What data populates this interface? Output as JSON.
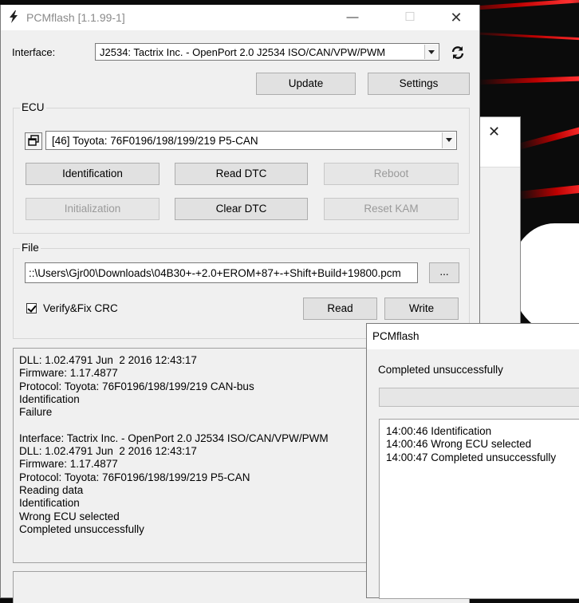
{
  "window": {
    "title": "PCMflash [1.1.99-1]",
    "minimize_glyph": "—",
    "maximize_glyph": "☐",
    "close_glyph": "✕"
  },
  "interface": {
    "label": "Interface:",
    "selected": "J2534: Tactrix Inc. - OpenPort 2.0 J2534 ISO/CAN/VPW/PWM",
    "refresh_icon": "refresh-icon"
  },
  "toolbar": {
    "update_label": "Update",
    "settings_label": "Settings"
  },
  "ecu": {
    "title": "ECU",
    "selected": "[46] Toyota: 76F0196/198/199/219 P5-CAN",
    "buttons": {
      "identification": "Identification",
      "read_dtc": "Read DTC",
      "reboot": "Reboot",
      "initialization": "Initialization",
      "clear_dtc": "Clear DTC",
      "reset_kam": "Reset KAM"
    }
  },
  "file": {
    "title": "File",
    "path": "::\\Users\\Gjr00\\Downloads\\04B30+-+2.0+EROM+87+-+Shift+Build+19800.pcm",
    "browse_label": "...",
    "verify_label": "Verify&Fix CRC",
    "verify_checked": true,
    "read_label": "Read",
    "write_label": "Write"
  },
  "log": {
    "lines": [
      "DLL: 1.02.4791 Jun  2 2016 12:43:17",
      "Firmware: 1.17.4877",
      "Protocol: Toyota: 76F0196/198/199/219 CAN-bus",
      "Identification",
      "Failure",
      "",
      "Interface: Tactrix Inc. - OpenPort 2.0 J2534 ISO/CAN/VPW/PWM",
      "DLL: 1.02.4791 Jun  2 2016 12:43:17",
      "Firmware: 1.17.4877",
      "Protocol: Toyota: 76F0196/198/199/219 P5-CAN",
      "Reading data",
      "Identification",
      "Wrong ECU selected",
      "Completed unsuccessfully"
    ]
  },
  "dialog": {
    "title": "PCMflash",
    "status": "Completed unsuccessfully",
    "log": [
      "14:00:46 Identification",
      "14:00:46 Wrong ECU selected",
      "14:00:47 Completed unsuccessfully"
    ]
  },
  "behind_dialog": {
    "close_glyph": "✕"
  }
}
